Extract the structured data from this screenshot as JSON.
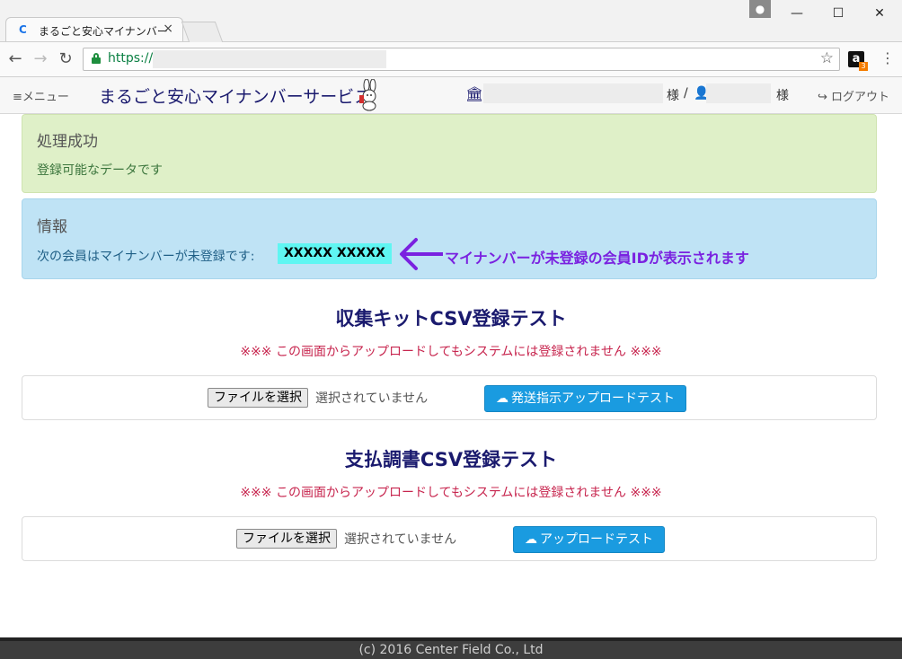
{
  "browser": {
    "tab_title": "まるごと安心マイナンバー",
    "tab_close": "×",
    "url": "https://",
    "window_controls": {
      "minimize": "—",
      "maximize": "☐",
      "close": "✕"
    },
    "extension_badge": "3",
    "extension_label": "a"
  },
  "nav": {
    "menu_label": "≡メニュー",
    "brand": "まるごと安心マイナンバーサービス",
    "org_icon": "bank-icon",
    "sama_1": "様",
    "separator": "/",
    "user_icon": "user-icon",
    "sama_2": "様",
    "logout_label": "ログアウト"
  },
  "alerts": {
    "success": {
      "title": "処理成功",
      "message": "登録可能なデータです"
    },
    "info": {
      "title": "情報",
      "message": "次の会員はマイナンバーが未登録です:",
      "member_id": "XXXXX XXXXX",
      "annotation": "マイナンバーが未登録の会員IDが表示されます"
    }
  },
  "sections": [
    {
      "title": "収集キットCSV登録テスト",
      "warning": "※※※ この画面からアップロードしてもシステムには登録されません ※※※",
      "file_button": "ファイルを選択",
      "file_status": "選択されていません",
      "upload_button": "発送指示アップロードテスト"
    },
    {
      "title": "支払調書CSV登録テスト",
      "warning": "※※※ この画面からアップロードしてもシステムには登録されません ※※※",
      "file_button": "ファイルを選択",
      "file_status": "選択されていません",
      "upload_button": "アップロードテスト"
    }
  ],
  "footer": "(c) 2016 Center Field Co., Ltd",
  "colors": {
    "accent": "#1a9be0",
    "brand": "#1a1a6e",
    "annotation": "#7a22e0",
    "highlight": "#5ff6f2",
    "warning": "#c7254e"
  }
}
